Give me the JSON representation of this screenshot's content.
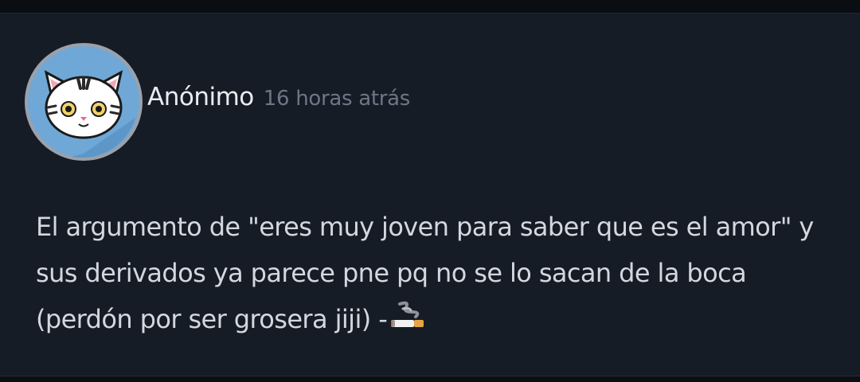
{
  "post": {
    "author": "Anónimo",
    "timestamp": "16 horas atrás",
    "avatar_icon": "cat-face-icon",
    "message_lines": [
      "El argumento de \"eres muy joven para saber que es el amor\" y",
      "sus derivados ya parece pne pq no se lo sacan de la boca",
      "(perdón por ser grosera jiji) -"
    ],
    "trailing_emoji": "cigarette-icon"
  },
  "colors": {
    "background": "#161c26",
    "author": "#e9edf2",
    "timestamp": "#6c7786",
    "message": "#d3d8df",
    "avatar_bg": "#6fa8d6"
  }
}
